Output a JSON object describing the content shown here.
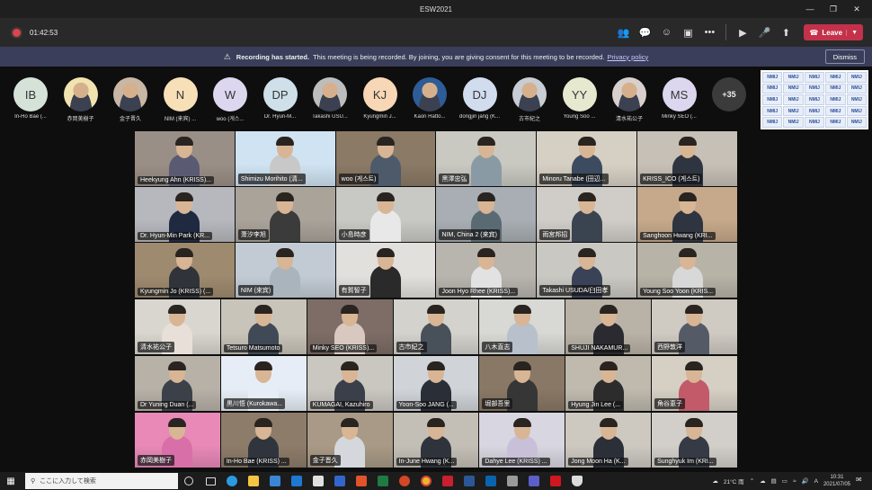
{
  "window": {
    "title": "ESW2021"
  },
  "toolbar": {
    "timer": "01:42:53",
    "leave_label": "Leave"
  },
  "banner": {
    "bold": "Recording has started.",
    "text": "This meeting is being recorded. By joining, you are giving consent for this meeting to be recorded.",
    "link": "Privacy policy",
    "dismiss": "Dismiss"
  },
  "participants": [
    {
      "initials": "IB",
      "name": "In-Ho Bae (...",
      "color": "#d5e2d8"
    },
    {
      "initials": "",
      "name": "赤岡美樹子",
      "color": "#f1e3b0"
    },
    {
      "initials": "",
      "name": "金子晋久",
      "color": "#c9b7a5"
    },
    {
      "initials": "N",
      "name": "NIM (来宾) ...",
      "color": "#f7dfb8"
    },
    {
      "initials": "W",
      "name": "woo (게스...",
      "color": "#dcd7ef"
    },
    {
      "initials": "DP",
      "name": "Dr. Hyun-M...",
      "color": "#cfe0ea"
    },
    {
      "initials": "",
      "name": "Takashi USU...",
      "color": "#bdbdbd"
    },
    {
      "initials": "KJ",
      "name": "Kyungmin J...",
      "color": "#f7d7b5"
    },
    {
      "initials": "",
      "name": "Kaori Hatto...",
      "color": "#2d5c96"
    },
    {
      "initials": "DJ",
      "name": "dongjin jang (K...",
      "color": "#d2dcef"
    },
    {
      "initials": "",
      "name": "古市紀之",
      "color": "#c8ccd4"
    },
    {
      "initials": "YY",
      "name": "Young Soo ...",
      "color": "#e6e9cf"
    },
    {
      "initials": "",
      "name": "清水祐公子",
      "color": "#d8d0cc"
    },
    {
      "initials": "MS",
      "name": "Minky SEO (...",
      "color": "#dcd7ef"
    },
    {
      "initials": "+35",
      "name": "",
      "color": "#3b3b3b"
    }
  ],
  "share_label": "NMIJ",
  "tiles": [
    [
      {
        "name": "Heekyung Ahn (KRISS)...",
        "bg": "#9a8f86",
        "shirt": "#5a5a72"
      },
      {
        "name": "Shimizu Morihito (清...",
        "bg": "#cfe3f2",
        "shirt": "#c8c8c8"
      },
      {
        "name": "woo (게스트)",
        "bg": "#8b7a66",
        "shirt": "#4d5a6a"
      },
      {
        "name": "黑澤忠弘",
        "bg": "#c9c9c2",
        "shirt": "#8a9aa5"
      },
      {
        "name": "Minoru Tanabe (田辺...",
        "bg": "#d6d0c4",
        "shirt": "#3d4b60"
      },
      {
        "name": "KRISS_ICO (게스트)",
        "bg": "#c7c0b6",
        "shirt": "#2f3540"
      }
    ],
    [
      {
        "name": "Dr. Hyun-Min Park (KR...",
        "bg": "#b7b8bd",
        "shirt": "#1f2940"
      },
      {
        "name": "萧汐李旭",
        "bg": "#aaa39a",
        "shirt": "#3b3b3b"
      },
      {
        "name": "小島時彦",
        "bg": "#c8c8c4",
        "shirt": "#e8e8e8"
      },
      {
        "name": "NIM, China 2 (来宾)",
        "bg": "#a8aeb3",
        "shirt": "#5a6a72"
      },
      {
        "name": "雨宮邦招",
        "bg": "#d0cdc8",
        "shirt": "#3a4450"
      },
      {
        "name": "Sanghoon Hwang (KRI...",
        "bg": "#c6a98a",
        "shirt": "#2e3440"
      }
    ],
    [
      {
        "name": "Kyungmin Jo (KRISS) (...",
        "bg": "#9e8a6f",
        "shirt": "#30343a"
      },
      {
        "name": "NIM (来宾)",
        "bg": "#c2cbd4",
        "shirt": "#aab4bd"
      },
      {
        "name": "有賀智子",
        "bg": "#e2e0dc",
        "shirt": "#2a2a2a"
      },
      {
        "name": "Joon Hyo Rhee (KRISS)...",
        "bg": "#b8b4ae",
        "shirt": "#e2e2e2"
      },
      {
        "name": "Takashi USUDA/臼田孝",
        "bg": "#c9c8c2",
        "shirt": "#3a4258"
      },
      {
        "name": "Young Soo Yoon (KRIS...",
        "bg": "#b8b3a7",
        "shirt": "#d8d8d8"
      }
    ],
    [
      {
        "name": "清水祐公子",
        "bg": "#d9d6d0",
        "shirt": "#e8e0d8"
      },
      {
        "name": "Tetsuro Matsumoto",
        "bg": "#c9c4b9",
        "shirt": "#3f4a56"
      },
      {
        "name": "Minky SEO (KRISS)...",
        "bg": "#7d6d66",
        "shirt": "#d8c8c0"
      },
      {
        "name": "古市紀之",
        "bg": "#d4d2cd",
        "shirt": "#48505a"
      },
      {
        "name": "八木直志",
        "bg": "#d8d8d4",
        "shirt": "#b8c0cc"
      },
      {
        "name": "SHUJI NAKAMUR...",
        "bg": "#b9b2a6",
        "shirt": "#2a2a30"
      },
      {
        "name": "西野敦洋",
        "bg": "#cfcac2",
        "shirt": "#555b66"
      }
    ],
    [
      {
        "name": "Dr Yuning Duan (...",
        "bg": "#b8b1a8",
        "shirt": "#3c4048"
      },
      {
        "name": "黒川悟 (Kurokawa...",
        "bg": "#e6edf6",
        "shirt": "#e6edf6"
      },
      {
        "name": "KUMAGAI, Kazuhiro",
        "bg": "#cac7c1",
        "shirt": "#3a3f4a"
      },
      {
        "name": "Yoon-Soo JANG (...",
        "bg": "#d0d4d8",
        "shirt": "#2a2e36"
      },
      {
        "name": "堀部吾里",
        "bg": "#8a7866",
        "shirt": "#363636"
      },
      {
        "name": "Hyung Jin Lee (...",
        "bg": "#bfb9ae",
        "shirt": "#2c2c2c"
      },
      {
        "name": "角谷恵子",
        "bg": "#d6cfc4",
        "shirt": "#c25a6a"
      }
    ],
    [
      {
        "name": "赤岡美樹子",
        "bg": "#e889b8",
        "shirt": "#d96fa8"
      },
      {
        "name": "In-Ho Bae (KRISS) ...",
        "bg": "#8e7c6a",
        "shirt": "#30353d"
      },
      {
        "name": "金子晋久",
        "bg": "#a89a86",
        "shirt": "#d4d8dc"
      },
      {
        "name": "In-June Hwang (K...",
        "bg": "#c4bfb6",
        "shirt": "#2f343c"
      },
      {
        "name": "Dahye Lee (KRISS) ...",
        "bg": "#d8d6e0",
        "shirt": "#c8c0d8"
      },
      {
        "name": "Jong Moon Ha (K...",
        "bg": "#cdc9c1",
        "shirt": "#2b2f38"
      },
      {
        "name": "Sunghyuk Im (KRI...",
        "bg": "#d2cfca",
        "shirt": "#353a44"
      }
    ]
  ],
  "taskbar": {
    "search_placeholder": "ここに入力して検索",
    "weather": "21°C 雨",
    "ime": "A",
    "time": "10:31",
    "date": "2021/07/05"
  }
}
